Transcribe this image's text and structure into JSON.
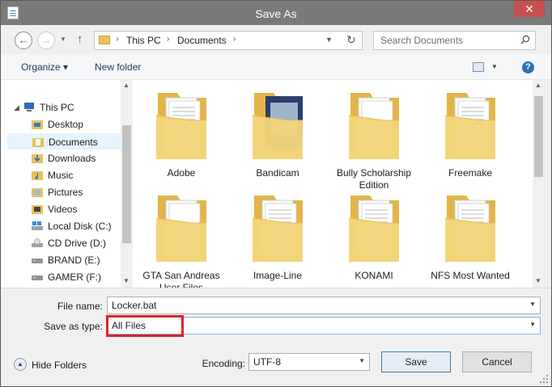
{
  "window": {
    "title": "Save As",
    "close_glyph": "✕"
  },
  "nav": {
    "back_glyph": "←",
    "forward_glyph": "→",
    "recent_glyph": "▼",
    "up_glyph": "↑",
    "breadcrumb": [
      "This PC",
      "Documents"
    ],
    "separator_glyph": "›",
    "search_placeholder": "Search Documents"
  },
  "toolbar": {
    "organize_label": "Organize ▾",
    "new_folder_label": "New folder",
    "help_glyph": "?"
  },
  "sidebar": {
    "items": [
      {
        "label": "This PC",
        "icon": "computer-icon"
      },
      {
        "label": "Desktop",
        "icon": "desktop-folder-icon"
      },
      {
        "label": "Documents",
        "icon": "documents-folder-icon",
        "selected": true
      },
      {
        "label": "Downloads",
        "icon": "downloads-folder-icon"
      },
      {
        "label": "Music",
        "icon": "music-folder-icon"
      },
      {
        "label": "Pictures",
        "icon": "pictures-folder-icon"
      },
      {
        "label": "Videos",
        "icon": "videos-folder-icon"
      },
      {
        "label": "Local Disk (C:)",
        "icon": "local-disk-icon"
      },
      {
        "label": "CD Drive (D:)",
        "icon": "cd-drive-icon"
      },
      {
        "label": "BRAND (E:)",
        "icon": "removable-drive-icon"
      },
      {
        "label": "GAMER (F:)",
        "icon": "removable-drive-icon"
      }
    ]
  },
  "files": [
    {
      "name": "Adobe",
      "icon": "folder-with-documents-icon"
    },
    {
      "name": "Bandicam",
      "icon": "folder-with-image-icon"
    },
    {
      "name": "Bully Scholarship Edition",
      "icon": "folder-with-pages-icon"
    },
    {
      "name": "Freemake",
      "icon": "folder-with-documents-icon"
    },
    {
      "name": "GTA San Andreas User Files",
      "icon": "folder-with-pages-icon"
    },
    {
      "name": "Image-Line",
      "icon": "folder-with-documents-icon"
    },
    {
      "name": "KONAMI",
      "icon": "folder-with-documents-icon"
    },
    {
      "name": "NFS Most Wanted",
      "icon": "folder-with-documents-icon"
    }
  ],
  "form": {
    "file_name_label": "File name:",
    "file_name_value": "Locker.bat",
    "save_type_label": "Save as type:",
    "save_type_value": "All Files",
    "encoding_label": "Encoding:",
    "encoding_value": "UTF-8",
    "hide_folders_label": "Hide Folders",
    "save_label": "Save",
    "cancel_label": "Cancel"
  },
  "colors": {
    "highlight_box": "#e0202a",
    "selected_row": "#e5f3fb",
    "folder_yellow": "#f0cf6a"
  }
}
